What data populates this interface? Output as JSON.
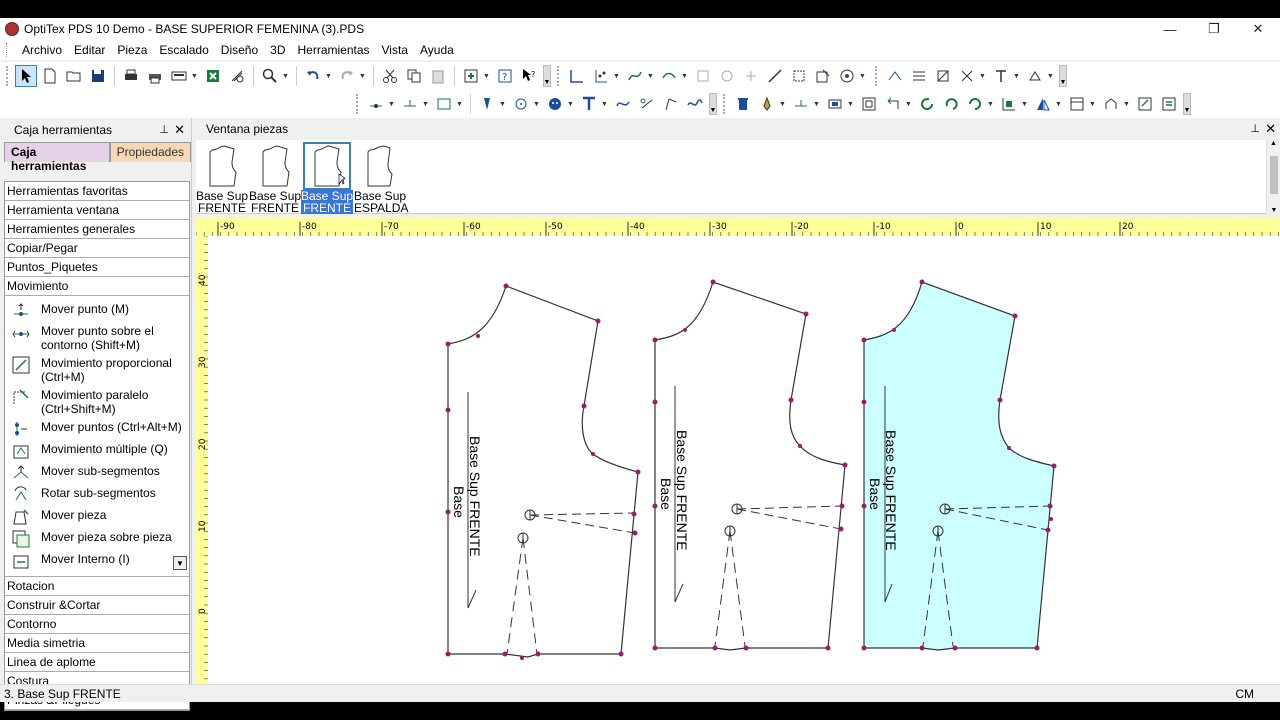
{
  "window": {
    "title": "OptiTex PDS 10 Demo - BASE SUPERIOR FEMENINA (3).PDS",
    "minimize": "—",
    "restore": "❐",
    "close": "✕"
  },
  "menu": [
    "Archivo",
    "Editar",
    "Pieza",
    "Escalado",
    "Diseño",
    "3D",
    "Herramientas",
    "Vista",
    "Ayuda"
  ],
  "toolbox": {
    "title": "Caja herramientas",
    "pin": "📌",
    "close": "✕",
    "tabs": {
      "active": "Caja herramientas",
      "inactive": "Propiedades"
    },
    "categories_top": [
      "Herramientas favoritas",
      "Herramienta ventana",
      "Herramientes generales",
      "Copiar/Pegar",
      "Puntos_Piquetes",
      "Movimiento"
    ],
    "tools": [
      {
        "label": "Mover punto (M)",
        "icon": "move-point-icon"
      },
      {
        "label": "Mover punto sobre el contorno (Shift+M)",
        "icon": "move-point-contour-icon"
      },
      {
        "label": "Movimiento proporcional (Ctrl+M)",
        "icon": "proportional-move-icon"
      },
      {
        "label": "Movimiento paralelo (Ctrl+Shift+M)",
        "icon": "parallel-move-icon"
      },
      {
        "label": "Mover puntos (Ctrl+Alt+M)",
        "icon": "move-points-icon"
      },
      {
        "label": "Movimiento múltiple (Q)",
        "icon": "multiple-move-icon"
      },
      {
        "label": "Mover sub-segmentos",
        "icon": "move-subsegments-icon"
      },
      {
        "label": "Rotar sub-segmentos",
        "icon": "rotate-subsegments-icon"
      },
      {
        "label": "Mover pieza",
        "icon": "move-piece-icon"
      },
      {
        "label": "Mover pieza sobre pieza",
        "icon": "move-piece-over-piece-icon"
      },
      {
        "label": "Mover Interno (I)",
        "icon": "move-internal-icon"
      }
    ],
    "categories_bottom": [
      "Rotacion",
      "Construir &Cortar",
      "Contorno",
      "Media simetria",
      "Linea de aplome",
      "Costura",
      "Pinzas &Pliegues"
    ]
  },
  "pieces_window": {
    "title": "Ventana piezas",
    "pieces": [
      {
        "line1": "Base Sup",
        "line2": "FRENTE",
        "selected": false
      },
      {
        "line1": "Base Sup",
        "line2": "FRENTE",
        "selected": false
      },
      {
        "line1": "Base Sup",
        "line2": "FRENTE",
        "selected": true
      },
      {
        "line1": "Base Sup",
        "line2": "ESPALDA",
        "selected": false
      }
    ]
  },
  "ruler": {
    "top_labels": [
      "-90",
      "-80",
      "-70",
      "-60",
      "-50",
      "-40",
      "-30",
      "-20",
      "-10",
      "0",
      "10",
      "20"
    ],
    "left_labels": [
      "40",
      "30",
      "20",
      "10",
      "0"
    ]
  },
  "canvas_pieces": [
    {
      "label": "Base Sup FRENTE",
      "sublabel": "Base",
      "filled": false
    },
    {
      "label": "Base Sup FRENTE",
      "sublabel": "Base",
      "filled": false
    },
    {
      "label": "Base Sup FRENTE",
      "sublabel": "Base",
      "filled": true
    }
  ],
  "colors": {
    "fill": "#ccffff",
    "point": "#9b1c6e",
    "ruler": "#ffff99",
    "selection": "#3875d7"
  },
  "status": {
    "text": "3. Base Sup FRENTE",
    "units": "CM"
  }
}
